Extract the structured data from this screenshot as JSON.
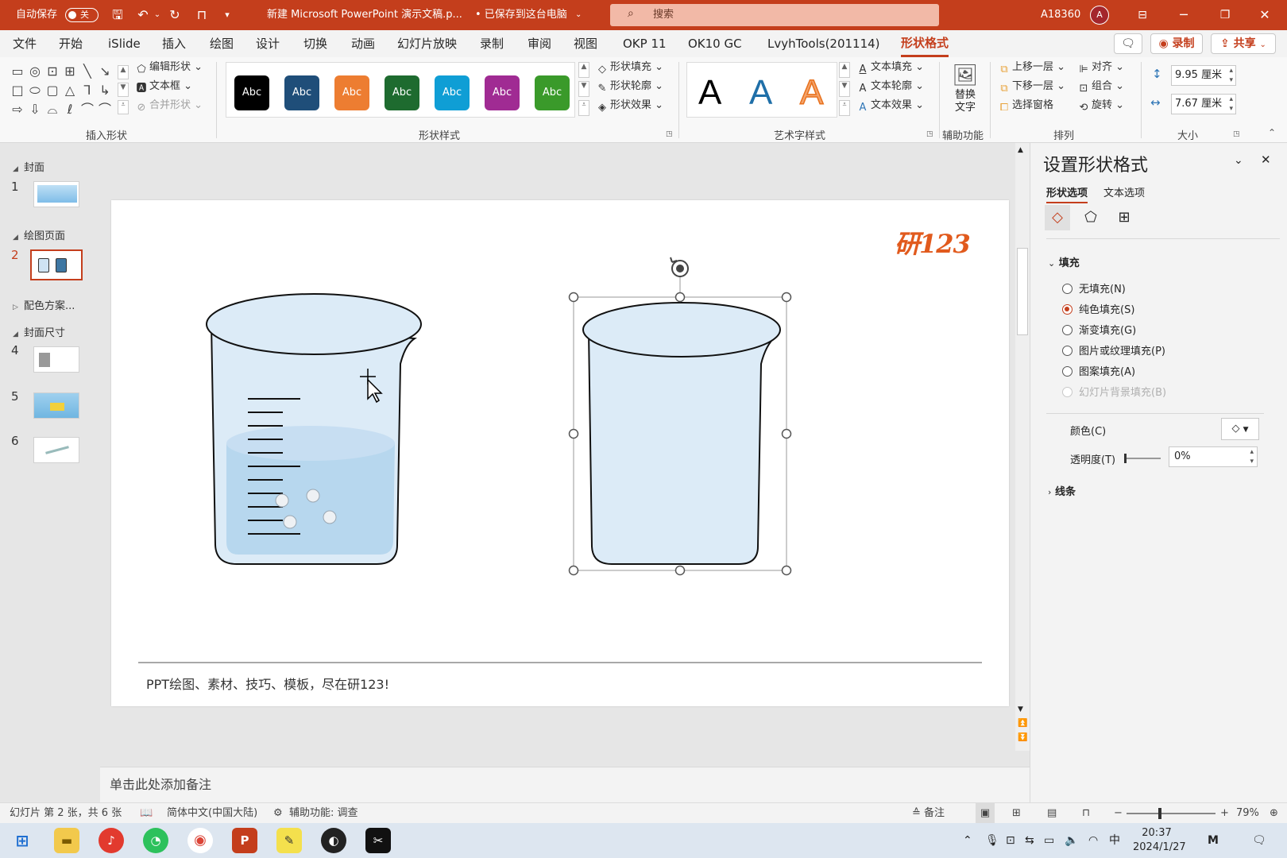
{
  "titlebar": {
    "autosave_label": "自动保存",
    "autosave_state": "关",
    "doc_title": "新建 Microsoft PowerPoint 演示文稿.p...",
    "save_status": "• 已保存到这台电脑",
    "search_placeholder": "搜索",
    "user_name": "A18360",
    "avatar_initial": "A"
  },
  "menu": {
    "tabs": [
      "文件",
      "开始",
      "iSlide",
      "插入",
      "绘图",
      "设计",
      "切换",
      "动画",
      "幻灯片放映",
      "录制",
      "审阅",
      "视图",
      "OKP 11",
      "OK10 GC",
      "LvyhTools(201114)",
      "形状格式"
    ],
    "active_tab": "形状格式",
    "record_label": "录制",
    "share_label": "共享"
  },
  "ribbon": {
    "insert_shapes": {
      "label": "插入形状",
      "edit_shape": "编辑形状",
      "text_box": "文本框",
      "merge_shapes": "合并形状"
    },
    "shape_styles": {
      "label": "形状样式",
      "swatches": [
        {
          "text": "Abc",
          "color": "#000000"
        },
        {
          "text": "Abc",
          "color": "#1f4e79"
        },
        {
          "text": "Abc",
          "color": "#ed7d31"
        },
        {
          "text": "Abc",
          "color": "#1e6b2f"
        },
        {
          "text": "Abc",
          "color": "#0f9ed5"
        },
        {
          "text": "Abc",
          "color": "#a02b93"
        },
        {
          "text": "Abc",
          "color": "#3a9a2a"
        }
      ],
      "fill": "形状填充",
      "outline": "形状轮廓",
      "effects": "形状效果"
    },
    "wordart": {
      "label": "艺术字样式",
      "samples": [
        "A",
        "A",
        "A"
      ],
      "text_fill": "文本填充",
      "text_outline": "文本轮廓",
      "text_effects": "文本效果"
    },
    "accessibility": {
      "label": "辅助功能",
      "alt_text_line1": "替换",
      "alt_text_line2": "文字"
    },
    "arrange": {
      "label": "排列",
      "bring_forward": "上移一层",
      "send_backward": "下移一层",
      "selection_pane": "选择窗格",
      "align": "对齐",
      "group": "组合",
      "rotate": "旋转"
    },
    "size": {
      "label": "大小",
      "height": "9.95 厘米",
      "width": "7.67 厘米"
    }
  },
  "thumbnails": {
    "sections": [
      {
        "title": "封面",
        "expanded": true
      },
      {
        "title": "绘图页面",
        "expanded": true
      },
      {
        "title": "配色方案...",
        "expanded": false
      },
      {
        "title": "封面尺寸",
        "expanded": true
      }
    ],
    "slide_numbers": [
      "1",
      "2",
      "4",
      "5",
      "6"
    ],
    "selected": "2"
  },
  "slide": {
    "logo_text": "研123",
    "footer_text": "PPT绘图、素材、技巧、模板，尽在研123!"
  },
  "notes_placeholder": "单击此处添加备注",
  "format_pane": {
    "title": "设置形状格式",
    "tab_shape": "形状选项",
    "tab_text": "文本选项",
    "fill_section": "填充",
    "fill_options": [
      {
        "label": "无填充(N)",
        "checked": false,
        "disabled": false
      },
      {
        "label": "纯色填充(S)",
        "checked": true,
        "disabled": false
      },
      {
        "label": "渐变填充(G)",
        "checked": false,
        "disabled": false
      },
      {
        "label": "图片或纹理填充(P)",
        "checked": false,
        "disabled": false
      },
      {
        "label": "图案填充(A)",
        "checked": false,
        "disabled": false
      },
      {
        "label": "幻灯片背景填充(B)",
        "checked": false,
        "disabled": true
      }
    ],
    "color_label": "颜色(C)",
    "transparency_label": "透明度(T)",
    "transparency_value": "0%",
    "transparency_fraction": 0,
    "line_section": "线条"
  },
  "statusbar": {
    "slide_info": "幻灯片 第 2 张，共 6 张",
    "language": "简体中文(中国大陆)",
    "accessibility": "辅助功能: 调查",
    "notes": "备注",
    "zoom": "79%"
  },
  "taskbar": {
    "time": "20:37",
    "date": "2024/1/27",
    "ime": "中"
  },
  "colors": {
    "accent": "#c43e1c",
    "beaker_fill": "#dcebf7",
    "water_fill": "#b7d7ee"
  }
}
